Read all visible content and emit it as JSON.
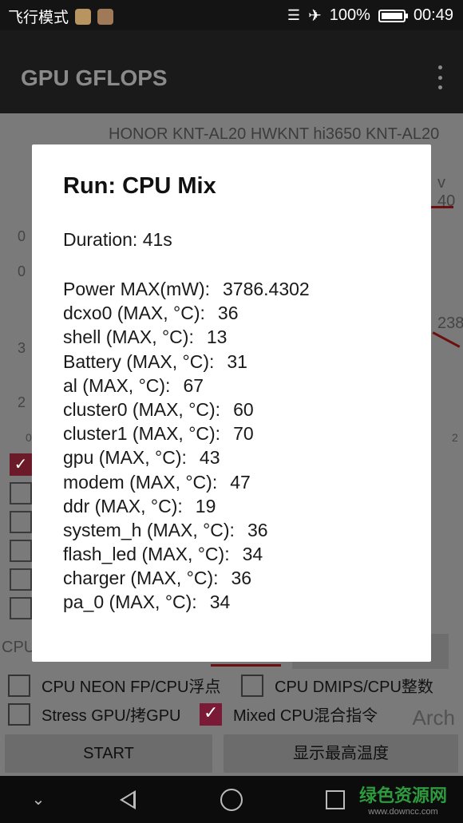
{
  "status_bar": {
    "left_text": "飞行模式",
    "battery": "100%",
    "battery_level": 1.0,
    "time": "00:49"
  },
  "app": {
    "title": "GPU GFLOPS"
  },
  "background": {
    "device_line": "HONOR KNT-AL20 HWKNT hi3650 KNT-AL20",
    "frag_right_top": "v 40",
    "frag_right_mid": "238",
    "frag_left_1": "0",
    "frag_left_2": "0",
    "frag_left_3": "3",
    "frag_left_4": "2",
    "frag_left_5": "0",
    "frag_right_axis": "2",
    "frag_cpu": "CPU",
    "options": [
      {
        "label": "CPU NEON FP/CPU浮点",
        "checked": false
      },
      {
        "label": "CPU DMIPS/CPU整数",
        "checked": false
      },
      {
        "label": "Stress GPU/拷GPU",
        "checked": false
      },
      {
        "label": "Mixed CPU混合指令",
        "checked": true
      }
    ],
    "arch": "Arch",
    "start_button": "START",
    "temp_button": "显示最高温度"
  },
  "dialog": {
    "title": "Run: CPU Mix",
    "duration": "Duration: 41s",
    "metrics": [
      {
        "label": "Power MAX(mW):",
        "value": "3786.4302"
      },
      {
        "label": "dcxo0 (MAX, °C):",
        "value": "36"
      },
      {
        "label": "shell (MAX, °C):",
        "value": "13"
      },
      {
        "label": "Battery (MAX, °C):",
        "value": "31"
      },
      {
        "label": "al (MAX, °C):",
        "value": "67"
      },
      {
        "label": "cluster0 (MAX, °C):",
        "value": "60"
      },
      {
        "label": "cluster1 (MAX, °C):",
        "value": "70"
      },
      {
        "label": "gpu (MAX, °C):",
        "value": "43"
      },
      {
        "label": "modem (MAX, °C):",
        "value": "47"
      },
      {
        "label": "ddr (MAX, °C):",
        "value": "19"
      },
      {
        "label": "system_h (MAX, °C):",
        "value": "36"
      },
      {
        "label": "flash_led (MAX, °C):",
        "value": "34"
      },
      {
        "label": "charger (MAX, °C):",
        "value": "36"
      },
      {
        "label": "pa_0 (MAX, °C):",
        "value": "34"
      }
    ]
  },
  "watermark": {
    "main": "绿色资源网",
    "sub": "www.downcc.com"
  },
  "icons": {
    "vibrate": "vibrate-icon",
    "airplane": "airplane-icon",
    "battery": "battery-icon",
    "menu": "overflow-menu-icon",
    "back": "back-icon",
    "home": "home-icon",
    "recent": "recent-apps-icon",
    "down": "chevron-down-icon"
  }
}
